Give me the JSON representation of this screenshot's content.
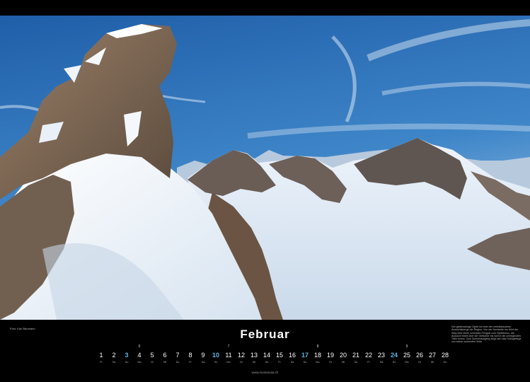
{
  "photo": {
    "alt_subject": "snow-covered-alpine-peaks"
  },
  "footer": {
    "credit": "Foto: Karl Baumann",
    "month": "Februar",
    "description": "Der gleichnamige Gipfel ist einer der meistbesuchten Aussichtsberge der Region. Von der Nordseite her führt der Weg über einen schmalen Firngrat zum Gipfelkreuz, die Aussicht reicht über die Gletscher bis weit in die umliegenden Täler hinein. Zum Sonnenaufgang zeigt sich das Hochgebirge von seiner schönsten Seite.",
    "website": "www.montanaia.ch"
  },
  "calendar": {
    "highlight_color": "#5ab4e6",
    "days": [
      {
        "n": "1",
        "wd": "Fr",
        "wk": "",
        "hl": false
      },
      {
        "n": "2",
        "wd": "Sa",
        "wk": "",
        "hl": false
      },
      {
        "n": "3",
        "wd": "So",
        "wk": "",
        "hl": true
      },
      {
        "n": "4",
        "wd": "Mo",
        "wk": "6",
        "hl": false
      },
      {
        "n": "5",
        "wd": "Di",
        "wk": "",
        "hl": false
      },
      {
        "n": "6",
        "wd": "Mi",
        "wk": "",
        "hl": false
      },
      {
        "n": "7",
        "wd": "Do",
        "wk": "",
        "hl": false
      },
      {
        "n": "8",
        "wd": "Fr",
        "wk": "",
        "hl": false
      },
      {
        "n": "9",
        "wd": "Sa",
        "wk": "",
        "hl": false
      },
      {
        "n": "10",
        "wd": "So",
        "wk": "",
        "hl": true
      },
      {
        "n": "11",
        "wd": "Mo",
        "wk": "7",
        "hl": false
      },
      {
        "n": "12",
        "wd": "Di",
        "wk": "",
        "hl": false
      },
      {
        "n": "13",
        "wd": "Mi",
        "wk": "",
        "hl": false
      },
      {
        "n": "14",
        "wd": "Do",
        "wk": "",
        "hl": false
      },
      {
        "n": "15",
        "wd": "Fr",
        "wk": "",
        "hl": false
      },
      {
        "n": "16",
        "wd": "Sa",
        "wk": "",
        "hl": false
      },
      {
        "n": "17",
        "wd": "So",
        "wk": "",
        "hl": true
      },
      {
        "n": "18",
        "wd": "Mo",
        "wk": "8",
        "hl": false
      },
      {
        "n": "19",
        "wd": "Di",
        "wk": "",
        "hl": false
      },
      {
        "n": "20",
        "wd": "Mi",
        "wk": "",
        "hl": false
      },
      {
        "n": "21",
        "wd": "Do",
        "wk": "",
        "hl": false
      },
      {
        "n": "22",
        "wd": "Fr",
        "wk": "",
        "hl": false
      },
      {
        "n": "23",
        "wd": "Sa",
        "wk": "",
        "hl": false
      },
      {
        "n": "24",
        "wd": "So",
        "wk": "",
        "hl": true
      },
      {
        "n": "25",
        "wd": "Mo",
        "wk": "9",
        "hl": false
      },
      {
        "n": "26",
        "wd": "Di",
        "wk": "",
        "hl": false
      },
      {
        "n": "27",
        "wd": "Mi",
        "wk": "",
        "hl": false
      },
      {
        "n": "28",
        "wd": "Do",
        "wk": "",
        "hl": false
      }
    ]
  }
}
